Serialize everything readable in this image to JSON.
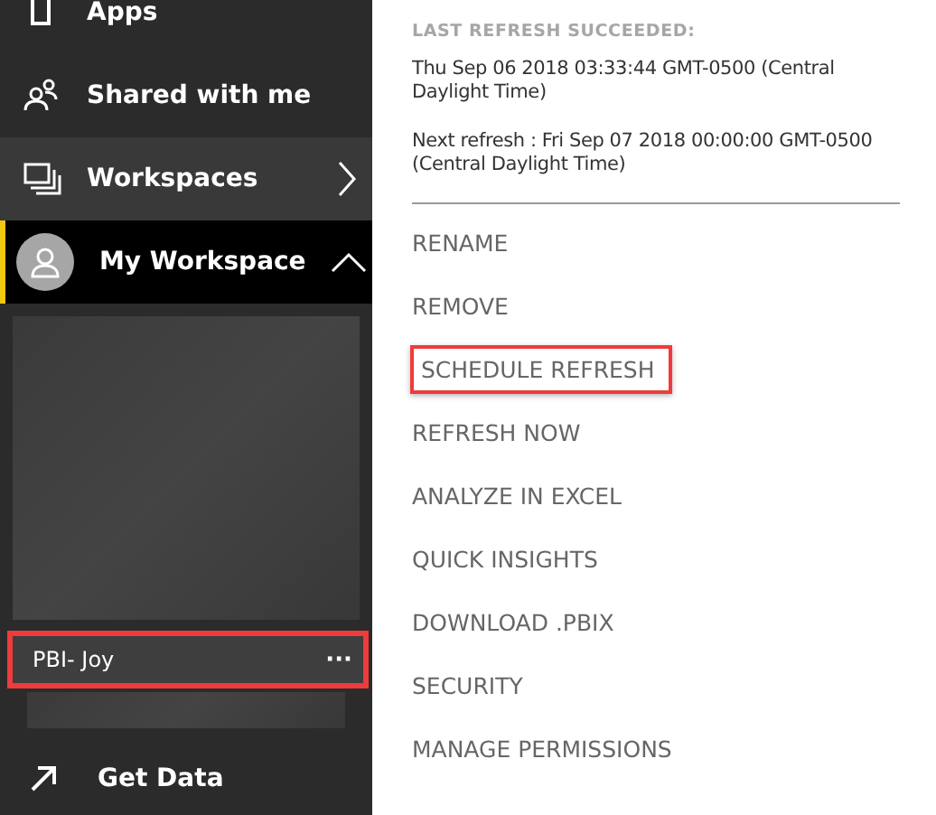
{
  "sidebar": {
    "nav": [
      {
        "label": "Apps",
        "kind": "plain"
      },
      {
        "label": "Shared with me",
        "kind": "plain"
      },
      {
        "label": "Workspaces",
        "kind": "submenu"
      },
      {
        "label": "My Workspace",
        "kind": "expanded"
      }
    ],
    "datasets": [
      {
        "name": "PBI- Joy",
        "selected": true,
        "highlighted": true,
        "more": "···"
      }
    ],
    "footer": {
      "label": "Get Data"
    }
  },
  "menu": {
    "status_heading": "LAST REFRESH SUCCEEDED:",
    "last_refresh": "Thu Sep 06 2018 03:33:44 GMT-0500 (Central Daylight Time)",
    "next_refresh": "Next refresh : Fri Sep 07 2018 00:00:00 GMT-0500 (Central Daylight Time)",
    "items": [
      {
        "label": "RENAME",
        "highlighted": false
      },
      {
        "label": "REMOVE",
        "highlighted": false
      },
      {
        "label": "SCHEDULE REFRESH",
        "highlighted": true
      },
      {
        "label": "REFRESH NOW",
        "highlighted": false
      },
      {
        "label": "ANALYZE IN EXCEL",
        "highlighted": false
      },
      {
        "label": "QUICK INSIGHTS",
        "highlighted": false
      },
      {
        "label": "DOWNLOAD .PBIX",
        "highlighted": false
      },
      {
        "label": "SECURITY",
        "highlighted": false
      },
      {
        "label": "MANAGE PERMISSIONS",
        "highlighted": false
      }
    ]
  }
}
